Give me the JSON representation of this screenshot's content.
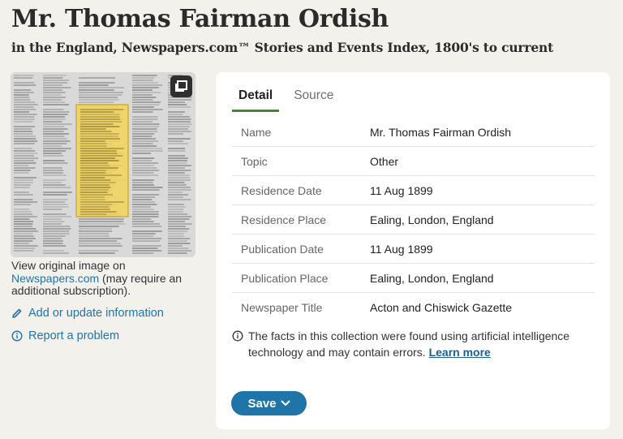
{
  "header": {
    "title": "Mr. Thomas Fairman Ordish",
    "subtitle": "in the England, Newspapers.com™ Stories and Events Index, 1800's to current"
  },
  "sidebar": {
    "view_original_prefix": "View original image on",
    "view_original_link": "Newspapers.com",
    "view_original_suffix": "(may require an additional subscription).",
    "add_update_label": "Add or update information",
    "report_problem_label": "Report a problem"
  },
  "tabs": [
    {
      "label": "Detail",
      "active": true
    },
    {
      "label": "Source",
      "active": false
    }
  ],
  "facts": [
    {
      "label": "Name",
      "value": "Mr. Thomas Fairman Ordish"
    },
    {
      "label": "Topic",
      "value": "Other"
    },
    {
      "label": "Residence Date",
      "value": "11 Aug 1899"
    },
    {
      "label": "Residence Place",
      "value": "Ealing, London, England"
    },
    {
      "label": "Publication Date",
      "value": "11 Aug 1899"
    },
    {
      "label": "Publication Place",
      "value": "Ealing, London, England"
    },
    {
      "label": "Newspaper Title",
      "value": "Acton and Chiswick Gazette"
    }
  ],
  "ai_note": {
    "text": "The facts in this collection were found using artificial intelligence technology and may contain errors.",
    "link": "Learn more"
  },
  "save_label": "Save",
  "icons": {
    "expand": "expand-icon",
    "edit": "pencil-icon",
    "report": "info-icon",
    "note": "info-icon",
    "save_chevron": "chevron-down-icon"
  },
  "colors": {
    "background": "#f3f1ec",
    "link": "#1f74a8",
    "tab_active_underline": "#3d8a31",
    "save_button": "#1f74a8",
    "highlight": "#f4d55a"
  }
}
